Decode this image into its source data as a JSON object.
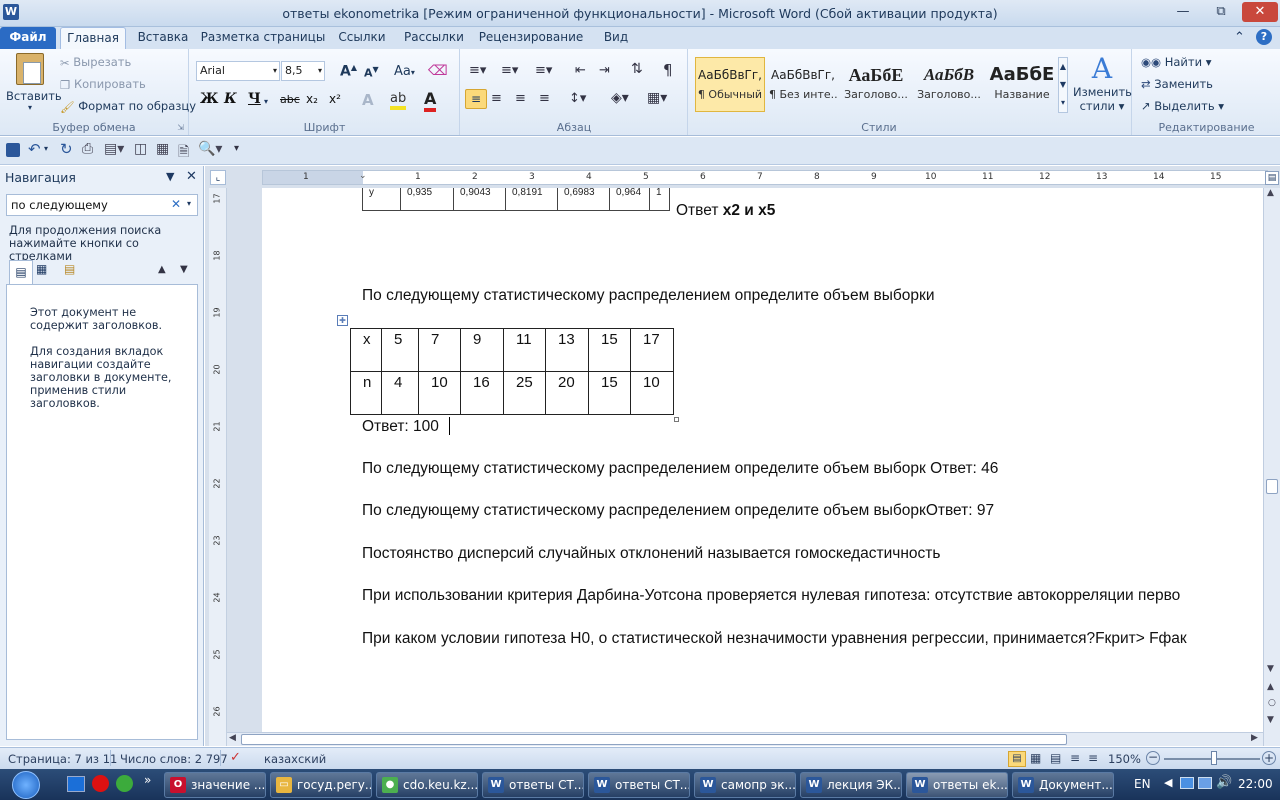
{
  "window": {
    "title": "ответы ekonometrika [Режим ограниченной функциональности]  -  Microsoft Word (Сбой активации продукта)",
    "app_icon_letter": "W"
  },
  "ribbon_tabs": [
    "Файл",
    "Главная",
    "Вставка",
    "Разметка страницы",
    "Ссылки",
    "Рассылки",
    "Рецензирование",
    "Вид"
  ],
  "clipboard": {
    "paste": "Вставить",
    "cut": "Вырезать",
    "copy": "Копировать",
    "format_painter": "Формат по образцу",
    "group": "Буфер обмена"
  },
  "font": {
    "name": "Arial",
    "size": "8,5",
    "group": "Шрифт",
    "bold": "Ж",
    "italic": "К",
    "underline": "Ч",
    "strike": "abc",
    "sub": "x₂",
    "sup": "x²",
    "grow": "A",
    "shrink": "A",
    "case": "Aa"
  },
  "paragraph": {
    "group": "Абзац"
  },
  "styles": {
    "group": "Стили",
    "items": [
      {
        "sample": "АаБбВвГг,",
        "name": "¶ Обычный"
      },
      {
        "sample": "АаБбВвГг,",
        "name": "¶ Без инте..."
      },
      {
        "sample": "АаБбЕ",
        "name": "Заголово..."
      },
      {
        "sample": "АаБбВ",
        "name": "Заголово..."
      },
      {
        "sample": "АаБбЕ",
        "name": "Название"
      }
    ],
    "change_line1": "Изменить",
    "change_line2": "стили"
  },
  "editing": {
    "group": "Редактирование",
    "find": "Найти",
    "replace": "Заменить",
    "select": "Выделить"
  },
  "nav": {
    "title": "Навигация",
    "search_value": "по следующему",
    "hint": "Для продолжения поиска нажимайте кнопки со стрелками",
    "no_headings": "Этот документ не содержит заголовков.",
    "create_tabs": "Для создания вкладок навигации создайте заголовки в документе, применив стили заголовков."
  },
  "ruler": {
    "h_ticks": [
      "1",
      "1",
      "2",
      "3",
      "4",
      "5",
      "6",
      "7",
      "8",
      "9",
      "10",
      "11",
      "12",
      "13",
      "14",
      "15"
    ],
    "v_ticks": [
      "17",
      "18",
      "19",
      "20",
      "21",
      "22",
      "23",
      "24",
      "25",
      "26"
    ]
  },
  "document": {
    "top_table": {
      "cells": [
        "y",
        "0,935",
        "0,9043",
        "0,8191",
        "0,6983",
        "0,964",
        "1"
      ]
    },
    "answer1_prefix": "Ответ ",
    "answer1_bold": "x2 и x5",
    "q1": " По следующему статистическому распределением определите объем выборки",
    "freq_table": {
      "x": [
        "x",
        "5",
        "7",
        "9",
        "11",
        "13",
        "15",
        "17"
      ],
      "n": [
        "n",
        "4",
        "10",
        "16",
        "25",
        "20",
        "15",
        "10"
      ]
    },
    "answer2": "Ответ: 100",
    "lines": [
      "По следующему статистическому распределением определите объем выборк Ответ: 46",
      " По следующему статистическому распределением определите объем выборкОтвет: 97",
      "Постоянство дисперсий случайных отклонений называется гомоскедастичность",
      "При использовании критерия Дарбина-Уотсона проверяется нулевая гипотеза: отсутствие автокорреляции перво",
      "При каком условии гипотеза H0, о статистической незначимости уравнения регрессии, принимается?Fкрит> Fфак"
    ]
  },
  "status": {
    "page": "Страница: 7 из 11",
    "words": "Число слов: 2 797",
    "language": "казахский",
    "zoom": "150%"
  },
  "taskbar": {
    "items": [
      {
        "label": "значение ...",
        "icon_color": "#c8102e",
        "icon": "O"
      },
      {
        "label": "госуд.регу...",
        "icon_color": "#e8b640",
        "icon": "▭"
      },
      {
        "label": "cdo.keu.kz...",
        "icon_color": "#4caf50",
        "icon": "●"
      },
      {
        "label": "ответы СТ...",
        "icon_color": "#2b579a",
        "icon": "W"
      },
      {
        "label": "ответы СТ...",
        "icon_color": "#2b579a",
        "icon": "W"
      },
      {
        "label": "самопр эк...",
        "icon_color": "#2b579a",
        "icon": "W"
      },
      {
        "label": "лекция ЭК...",
        "icon_color": "#2b579a",
        "icon": "W"
      },
      {
        "label": "ответы ek...",
        "icon_color": "#2b579a",
        "icon": "W"
      },
      {
        "label": "Документ...",
        "icon_color": "#2b579a",
        "icon": "W"
      }
    ],
    "lang": "EN",
    "time": "22:00"
  }
}
